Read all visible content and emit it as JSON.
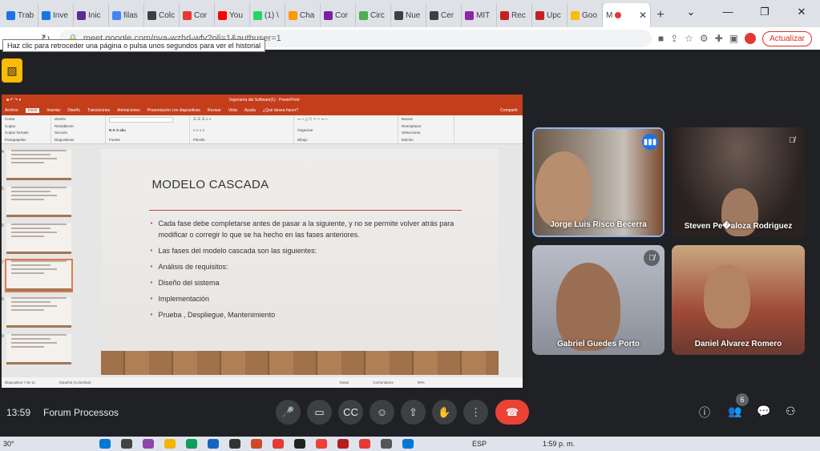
{
  "browser": {
    "tabs": [
      {
        "label": "Trab",
        "color": "#1a73e8"
      },
      {
        "label": "Inve",
        "color": "#1a73e8"
      },
      {
        "label": "Inic",
        "color": "#5c2d91"
      },
      {
        "label": "filas",
        "color": "#4285f4"
      },
      {
        "label": "Colc",
        "color": "#3c4043"
      },
      {
        "label": "Cor",
        "color": "#e53935"
      },
      {
        "label": "You",
        "color": "#ff0000"
      },
      {
        "label": "(1) \\",
        "color": "#25d366"
      },
      {
        "label": "Cha",
        "color": "#ff9800"
      },
      {
        "label": "Cor",
        "color": "#7b1fa2"
      },
      {
        "label": "Circ",
        "color": "#4caf50"
      },
      {
        "label": "Nue",
        "color": "#3c4043"
      },
      {
        "label": "Cer",
        "color": "#3c4043"
      },
      {
        "label": "MIT",
        "color": "#8e24aa"
      },
      {
        "label": "Rec",
        "color": "#c5221f"
      },
      {
        "label": "Upc",
        "color": "#c5221f"
      },
      {
        "label": "Goo",
        "color": "#fbbc04"
      }
    ],
    "active_tab": {
      "label": "M",
      "close": "✕"
    },
    "new_tab": "+",
    "window_controls": [
      "⌄",
      "—",
      "❐",
      "✕"
    ],
    "url": "meet.google.com/nva-wzhd-wfv?pli=1&authuser=1",
    "update_label": "Actualizar",
    "tooltip": "Haz clic para retroceder una página o pulsa unos segundos para ver el historial"
  },
  "presentation": {
    "title_bar": "Ingeniería del Software(1) · PowerPoint",
    "menu": [
      "Archivo",
      "Inicio",
      "Insertar",
      "Diseño",
      "Transiciones",
      "Animaciones",
      "Presentación con diapositivas",
      "Revisar",
      "Vista",
      "Ayuda",
      "¿Qué desea hacer?"
    ],
    "ribbon_groups": [
      "Portapapeles",
      "Diapositivas",
      "Fuente",
      "Párrafo",
      "Dibujo",
      "Edición"
    ],
    "ribbon_items": {
      "cortar": "Cortar",
      "copiar": "Copiar",
      "copiar_formato": "Copiar formato",
      "pegar": "Pegar",
      "nueva": "Nueva diapositiva",
      "diseno": "Diseño",
      "restablecer": "Restablecer",
      "seccion": "Sección",
      "buscar": "Buscar",
      "reemplazar": "Reemplazar",
      "seleccionar": "Seleccionar",
      "organizar": "Organizar",
      "compartir": "Compartir"
    },
    "thumbnail_numbers": [
      "4",
      "5",
      "6",
      "7",
      "8",
      "9"
    ],
    "selected_thumbnail": "7",
    "slide": {
      "title": "MODELO CASCADA",
      "bullets": [
        "Cada fase debe completarse antes de pasar a la siguiente, y no se permite volver atrás para modificar o corregir lo que se ha hecho en las fases anteriores.",
        "Las fases del modelo cascada son las siguientes:",
        "Análisis de requisitos:",
        "Diseño del sistema",
        "Implementación",
        "Prueba , Despliegue, Mantenimiento"
      ]
    },
    "status": {
      "slide_count": "Diapositiva 7 de 11",
      "language": "Español (Colombia)",
      "notes": "Notas",
      "comments": "Comentarios",
      "zoom": "99%"
    }
  },
  "participants": [
    {
      "name": "Jorge Luis Risco Becerra",
      "mic": "speaking",
      "bg": "#5a4a3a"
    },
    {
      "name": "Steven Pe�aloza Rodriguez",
      "mic": "muted",
      "bg": "#3a2e2a"
    },
    {
      "name": "Gabriel Guedes Porto",
      "mic": "muted",
      "bg": "#6a7080"
    },
    {
      "name": "Daniel Alvarez Romero",
      "mic": "none",
      "bg": "#8a5040"
    }
  ],
  "meeting": {
    "time": "13:59",
    "name": "Forum Processos",
    "people_count": "6"
  },
  "taskbar": {
    "weather": "30°",
    "lang": "ESP",
    "clock": "1:59 p. m."
  }
}
